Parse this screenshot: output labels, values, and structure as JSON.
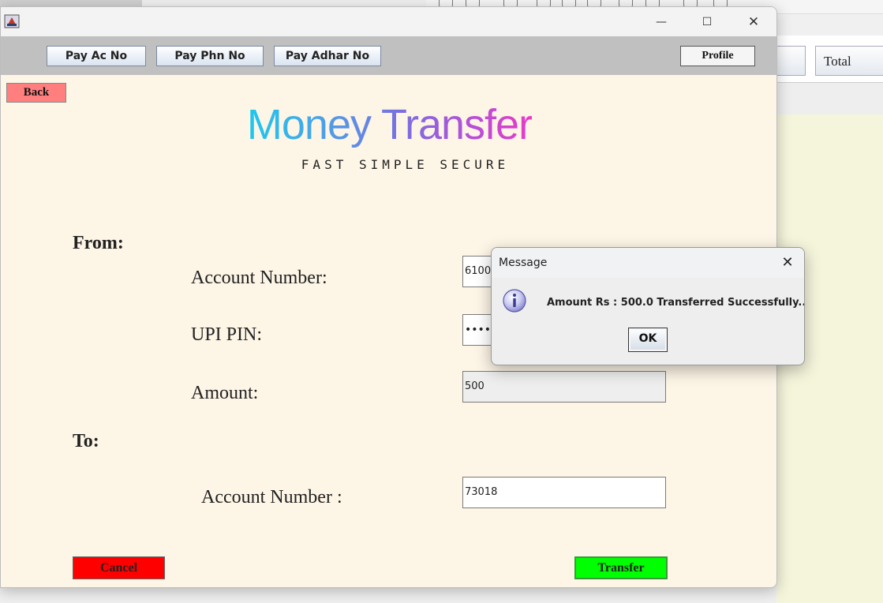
{
  "background_app": {
    "total_label": "Total"
  },
  "window": {
    "controls": {
      "minimize": "—",
      "maximize": "☐",
      "close": "✕"
    }
  },
  "menubar": {
    "pay_ac_no": "Pay Ac No",
    "pay_phn_no": "Pay Phn No",
    "pay_adhar_no": "Pay Adhar No",
    "profile": "Profile"
  },
  "back_label": "Back",
  "logo": {
    "title": "Money Transfer",
    "tagline": "FAST SIMPLE SECURE"
  },
  "form": {
    "from_label": "From:",
    "to_label": "To:",
    "from_account_label": "Account Number:",
    "from_account_value": "61001",
    "upi_pin_label": "UPI PIN:",
    "upi_pin_value": "••••",
    "amount_label": "Amount:",
    "amount_value": "500",
    "to_account_label": "Account Number :",
    "to_account_value": "73018"
  },
  "actions": {
    "cancel": "Cancel",
    "transfer": "Transfer"
  },
  "dialog": {
    "title": "Message",
    "close": "✕",
    "message": "Amount Rs : 500.0 Transferred Successfully..",
    "ok": "OK"
  },
  "colors": {
    "window_bg": "#fdf5e6",
    "menubar_bg": "#c0c0c0",
    "back_button": "#ff7f7f",
    "cancel_button": "#ff0000",
    "transfer_button": "#00ff00"
  }
}
